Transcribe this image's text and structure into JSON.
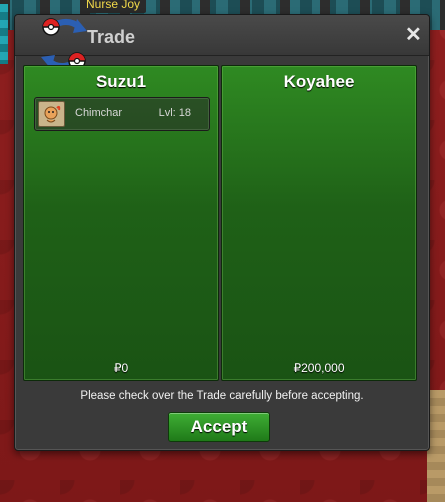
{
  "world": {
    "npc_name": "Nurse Joy"
  },
  "window": {
    "title": "Trade",
    "close_label": "✕",
    "note": "Please check over the Trade carefully before accepting.",
    "accept_label": "Accept"
  },
  "left_panel": {
    "player": "Suzu1",
    "money": "₽0",
    "pokemon": [
      {
        "name": "Chimchar",
        "level": "Lvl: 18",
        "icon": "chimchar-icon"
      }
    ]
  },
  "right_panel": {
    "player": "Koyahee",
    "money": "₽200,000",
    "pokemon": []
  },
  "colors": {
    "panel_green": "#1f6117",
    "button_green": "#2f8f25",
    "window_bg": "#3a3a3a"
  }
}
